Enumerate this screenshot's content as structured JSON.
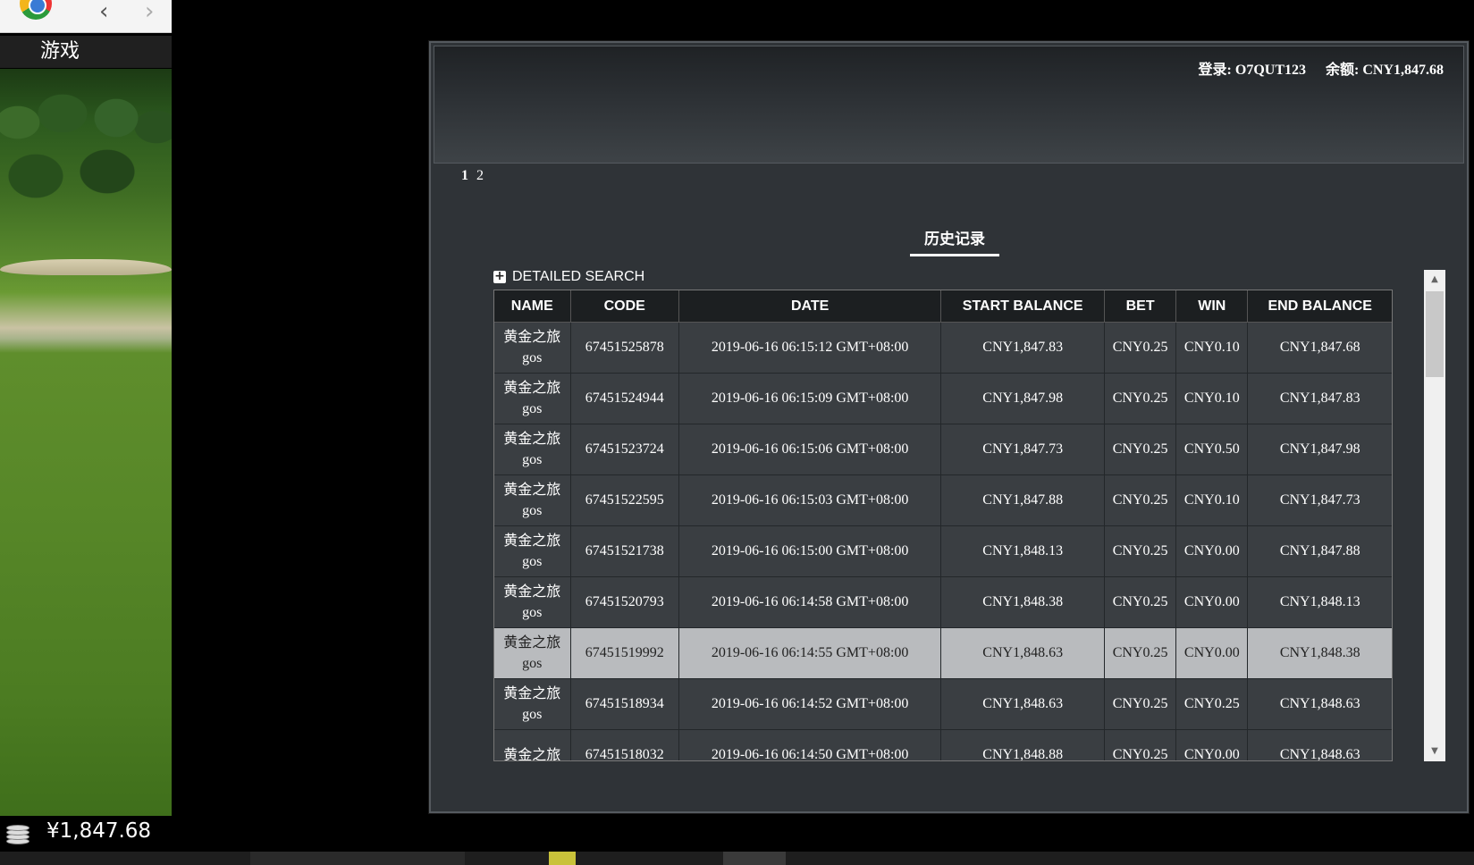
{
  "sidebar": {
    "games_label": "游戏",
    "balance": "¥1,847.68"
  },
  "header": {
    "login": "登录: O7QUT123",
    "balance": "余额: CNY1,847.68"
  },
  "pager": {
    "pages": [
      "1",
      "2"
    ],
    "current": "1"
  },
  "history": {
    "title": "历史记录",
    "detailed_search": "DETAILED SEARCH",
    "columns": [
      "NAME",
      "CODE",
      "DATE",
      "START BALANCE",
      "BET",
      "WIN",
      "END BALANCE"
    ],
    "rows": [
      {
        "name1": "黄金之旅",
        "name2": "gos",
        "code": "67451525878",
        "date": "2019-06-16 06:15:12 GMT+08:00",
        "start": "CNY1,847.83",
        "bet": "CNY0.25",
        "win": "CNY0.10",
        "end": "CNY1,847.68"
      },
      {
        "name1": "黄金之旅",
        "name2": "gos",
        "code": "67451524944",
        "date": "2019-06-16 06:15:09 GMT+08:00",
        "start": "CNY1,847.98",
        "bet": "CNY0.25",
        "win": "CNY0.10",
        "end": "CNY1,847.83"
      },
      {
        "name1": "黄金之旅",
        "name2": "gos",
        "code": "67451523724",
        "date": "2019-06-16 06:15:06 GMT+08:00",
        "start": "CNY1,847.73",
        "bet": "CNY0.25",
        "win": "CNY0.50",
        "end": "CNY1,847.98"
      },
      {
        "name1": "黄金之旅",
        "name2": "gos",
        "code": "67451522595",
        "date": "2019-06-16 06:15:03 GMT+08:00",
        "start": "CNY1,847.88",
        "bet": "CNY0.25",
        "win": "CNY0.10",
        "end": "CNY1,847.73"
      },
      {
        "name1": "黄金之旅",
        "name2": "gos",
        "code": "67451521738",
        "date": "2019-06-16 06:15:00 GMT+08:00",
        "start": "CNY1,848.13",
        "bet": "CNY0.25",
        "win": "CNY0.00",
        "end": "CNY1,847.88"
      },
      {
        "name1": "黄金之旅",
        "name2": "gos",
        "code": "67451520793",
        "date": "2019-06-16 06:14:58 GMT+08:00",
        "start": "CNY1,848.38",
        "bet": "CNY0.25",
        "win": "CNY0.00",
        "end": "CNY1,848.13"
      },
      {
        "name1": "黄金之旅",
        "name2": "gos",
        "code": "67451519992",
        "date": "2019-06-16 06:14:55 GMT+08:00",
        "start": "CNY1,848.63",
        "bet": "CNY0.25",
        "win": "CNY0.00",
        "end": "CNY1,848.38"
      },
      {
        "name1": "黄金之旅",
        "name2": "gos",
        "code": "67451518934",
        "date": "2019-06-16 06:14:52 GMT+08:00",
        "start": "CNY1,848.63",
        "bet": "CNY0.25",
        "win": "CNY0.25",
        "end": "CNY1,848.63"
      },
      {
        "name1": "黄金之旅",
        "name2": "",
        "code": "67451518032",
        "date": "2019-06-16 06:14:50 GMT+08:00",
        "start": "CNY1,848.88",
        "bet": "CNY0.25",
        "win": "CNY0.00",
        "end": "CNY1,848.63"
      }
    ],
    "highlighted_row": 6
  },
  "icons": {
    "browser": "browser-logo-icon",
    "back": "chevron-left-icon",
    "forward": "chevron-right-icon",
    "coins": "coins-icon",
    "expand": "plus-box-icon",
    "scroll_up": "triangle-up-icon",
    "scroll_down": "triangle-down-icon"
  },
  "colors": {
    "dialog_bg": "#2f3337",
    "row_bg": "#3a3e42",
    "row_highlight": "#b9bbbe",
    "header_bg": "#1c1f21"
  }
}
